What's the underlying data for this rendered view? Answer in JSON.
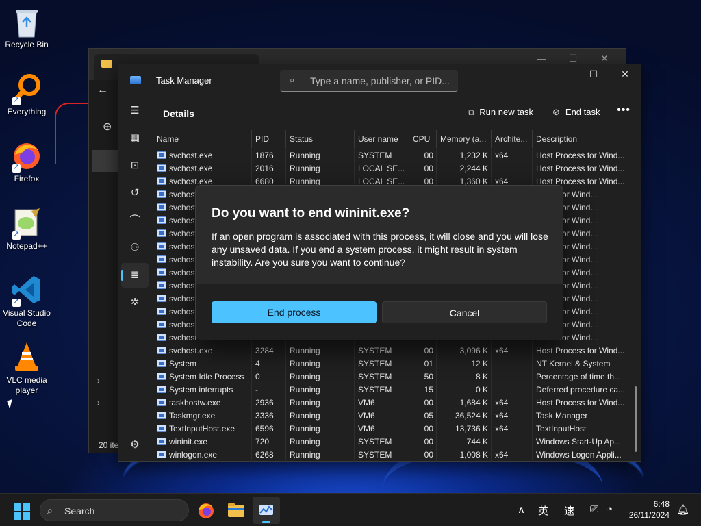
{
  "desktop": {
    "icons": [
      {
        "label": "Recycle Bin",
        "icon": "recycle-bin-icon"
      },
      {
        "label": "Everything",
        "icon": "everything-icon"
      },
      {
        "label": "Firefox",
        "icon": "firefox-icon"
      },
      {
        "label": "Notepad++",
        "icon": "notepad-plus-plus-icon"
      },
      {
        "label": "Visual Studio Code",
        "icon": "vscode-icon"
      },
      {
        "label": "VLC media player",
        "icon": "vlc-icon"
      }
    ]
  },
  "explorer": {
    "status": "20 ite",
    "buttons": {
      "minimize": "—",
      "maximize": "☐",
      "close": "✕"
    }
  },
  "taskmanager": {
    "title": "Task Manager",
    "search_placeholder": "Type a name, publisher, or PID...",
    "page_title": "Details",
    "run_new_task": "Run new task",
    "end_task": "End task",
    "more": "•••",
    "window_buttons": {
      "minimize": "—",
      "maximize": "☐",
      "close": "✕"
    },
    "columns": [
      "Name",
      "PID",
      "Status",
      "User name",
      "CPU",
      "Memory (a...",
      "Archite...",
      "Description"
    ],
    "rows": [
      {
        "name": "svchost.exe",
        "pid": "1876",
        "status": "Running",
        "user": "SYSTEM",
        "cpu": "00",
        "mem": "1,232 K",
        "arch": "x64",
        "desc": "Host Process for Wind..."
      },
      {
        "name": "svchost.exe",
        "pid": "2016",
        "status": "Running",
        "user": "LOCAL SE...",
        "cpu": "00",
        "mem": "2,244 K",
        "arch": "",
        "desc": "Host Process for Wind..."
      },
      {
        "name": "svchost.exe",
        "pid": "6680",
        "status": "Running",
        "user": "LOCAL SE...",
        "cpu": "00",
        "mem": "1,360 K",
        "arch": "x64",
        "desc": "Host Process for Wind..."
      },
      {
        "name": "svchost",
        "pid": "",
        "status": "",
        "user": "",
        "cpu": "",
        "mem": "",
        "arch": "",
        "desc": "ocess for Wind..."
      },
      {
        "name": "svchost",
        "pid": "",
        "status": "",
        "user": "",
        "cpu": "",
        "mem": "",
        "arch": "",
        "desc": "ocess for Wind..."
      },
      {
        "name": "svchost",
        "pid": "",
        "status": "",
        "user": "",
        "cpu": "",
        "mem": "",
        "arch": "",
        "desc": "ocess for Wind..."
      },
      {
        "name": "svchost",
        "pid": "",
        "status": "",
        "user": "",
        "cpu": "",
        "mem": "",
        "arch": "",
        "desc": "ocess for Wind..."
      },
      {
        "name": "svchost",
        "pid": "",
        "status": "",
        "user": "",
        "cpu": "",
        "mem": "",
        "arch": "",
        "desc": "ocess for Wind..."
      },
      {
        "name": "svchost",
        "pid": "",
        "status": "",
        "user": "",
        "cpu": "",
        "mem": "",
        "arch": "",
        "desc": "ocess for Wind..."
      },
      {
        "name": "svchost",
        "pid": "",
        "status": "",
        "user": "",
        "cpu": "",
        "mem": "",
        "arch": "",
        "desc": "ocess for Wind..."
      },
      {
        "name": "svchost",
        "pid": "",
        "status": "",
        "user": "",
        "cpu": "",
        "mem": "",
        "arch": "",
        "desc": "ocess for Wind..."
      },
      {
        "name": "svchost",
        "pid": "",
        "status": "",
        "user": "",
        "cpu": "",
        "mem": "",
        "arch": "",
        "desc": "ocess for Wind..."
      },
      {
        "name": "svchost",
        "pid": "",
        "status": "",
        "user": "",
        "cpu": "",
        "mem": "",
        "arch": "",
        "desc": "ocess for Wind..."
      },
      {
        "name": "svchost",
        "pid": "",
        "status": "",
        "user": "",
        "cpu": "",
        "mem": "",
        "arch": "",
        "desc": "ocess for Wind..."
      },
      {
        "name": "svchost",
        "pid": "",
        "status": "",
        "user": "",
        "cpu": "",
        "mem": "",
        "arch": "",
        "desc": "ocess for Wind..."
      },
      {
        "name": "svchost.exe",
        "pid": "3284",
        "status": "Running",
        "user": "SYSTEM",
        "cpu": "00",
        "mem": "3,096 K",
        "arch": "x64",
        "desc": "Host Process for Wind..."
      },
      {
        "name": "System",
        "pid": "4",
        "status": "Running",
        "user": "SYSTEM",
        "cpu": "01",
        "mem": "12 K",
        "arch": "",
        "desc": "NT Kernel & System"
      },
      {
        "name": "System Idle Process",
        "pid": "0",
        "status": "Running",
        "user": "SYSTEM",
        "cpu": "50",
        "mem": "8 K",
        "arch": "",
        "desc": "Percentage of time th..."
      },
      {
        "name": "System interrupts",
        "pid": "-",
        "status": "Running",
        "user": "SYSTEM",
        "cpu": "15",
        "mem": "0 K",
        "arch": "",
        "desc": "Deferred procedure ca..."
      },
      {
        "name": "taskhostw.exe",
        "pid": "2936",
        "status": "Running",
        "user": "VM6",
        "cpu": "00",
        "mem": "1,684 K",
        "arch": "x64",
        "desc": "Host Process for Wind..."
      },
      {
        "name": "Taskmgr.exe",
        "pid": "3336",
        "status": "Running",
        "user": "VM6",
        "cpu": "05",
        "mem": "36,524 K",
        "arch": "x64",
        "desc": "Task Manager"
      },
      {
        "name": "TextInputHost.exe",
        "pid": "6596",
        "status": "Running",
        "user": "VM6",
        "cpu": "00",
        "mem": "13,736 K",
        "arch": "x64",
        "desc": "TextInputHost"
      },
      {
        "name": "wininit.exe",
        "pid": "720",
        "status": "Running",
        "user": "SYSTEM",
        "cpu": "00",
        "mem": "744 K",
        "arch": "",
        "desc": "Windows Start-Up Ap..."
      },
      {
        "name": "winlogon.exe",
        "pid": "6268",
        "status": "Running",
        "user": "SYSTEM",
        "cpu": "00",
        "mem": "1,008 K",
        "arch": "x64",
        "desc": "Windows Logon Appli..."
      }
    ]
  },
  "dialog": {
    "title": "Do you want to end wininit.exe?",
    "message": "If an open program is associated with this process, it will close and you will lose any unsaved data. If you end a system process, it might result in system instability. Are you sure you want to continue?",
    "primary": "End process",
    "secondary": "Cancel"
  },
  "taskbar": {
    "search": "Search",
    "ime1": "英",
    "ime2": "速",
    "time": "6:48",
    "date": "26/11/2024"
  },
  "colors": {
    "accent": "#4cc2ff",
    "panel": "#202020",
    "dialog": "#2b2b2b"
  }
}
